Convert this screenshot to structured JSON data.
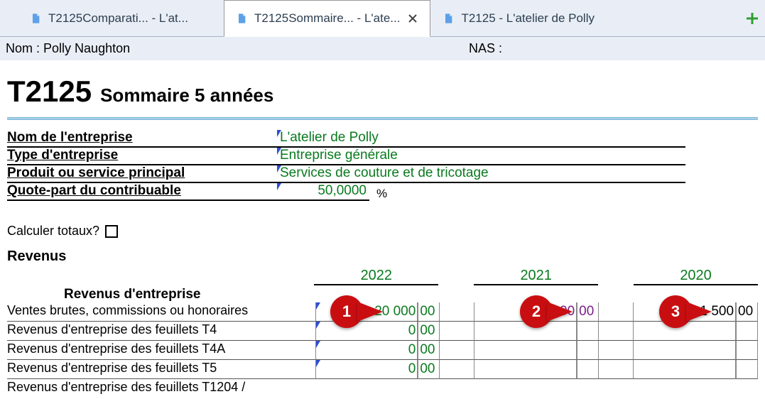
{
  "tabs": [
    {
      "label": "T2125Comparati... - L'at..."
    },
    {
      "label": "T2125Sommaire... - L'ate..."
    },
    {
      "label": "T2125 - L'atelier de Polly"
    }
  ],
  "ident": {
    "name_label": "Nom :",
    "name_value": "Polly Naughton",
    "nas_label": "NAS :",
    "nas_value": ""
  },
  "title": {
    "code": "T2125",
    "subtitle": "Sommaire 5 années"
  },
  "info": {
    "business_name_label": "Nom de l'entreprise",
    "business_name_value": "L'atelier de Polly",
    "type_label": "Type d'entreprise",
    "type_value": "Entreprise générale",
    "product_label": "Produit ou service principal",
    "product_value": "Services de couture et de tricotage",
    "share_label": "Quote-part du contribuable",
    "share_value": "50,0000",
    "share_unit": "%"
  },
  "calc": {
    "label": "Calculer totaux?"
  },
  "years": {
    "y1": "2022",
    "y2": "2021",
    "y3": "2020"
  },
  "revenus": {
    "section": "Revenus",
    "subsection": "Revenus d'entreprise",
    "rows": [
      {
        "label": "Ventes brutes, commissions ou honoraires",
        "y1": {
          "int": "20 000",
          "cents": "00",
          "cls": "c-green"
        },
        "y2": {
          "int": "3 600",
          "cents": "00",
          "cls": "c-purple"
        },
        "y3": {
          "int": "1 500",
          "cents": "00",
          "cls": "c-black"
        }
      },
      {
        "label": "Revenus d'entreprise des feuillets T4",
        "y1": {
          "int": "0",
          "cents": "00",
          "cls": "c-green"
        }
      },
      {
        "label": "Revenus d'entreprise des feuillets T4A",
        "y1": {
          "int": "0",
          "cents": "00",
          "cls": "c-green"
        }
      },
      {
        "label": "Revenus d'entreprise des feuillets T5",
        "y1": {
          "int": "0",
          "cents": "00",
          "cls": "c-green"
        }
      },
      {
        "label": "Revenus d'entreprise des feuillets T1204 /"
      }
    ]
  },
  "annotations": {
    "a1": "1",
    "a2": "2",
    "a3": "3"
  }
}
